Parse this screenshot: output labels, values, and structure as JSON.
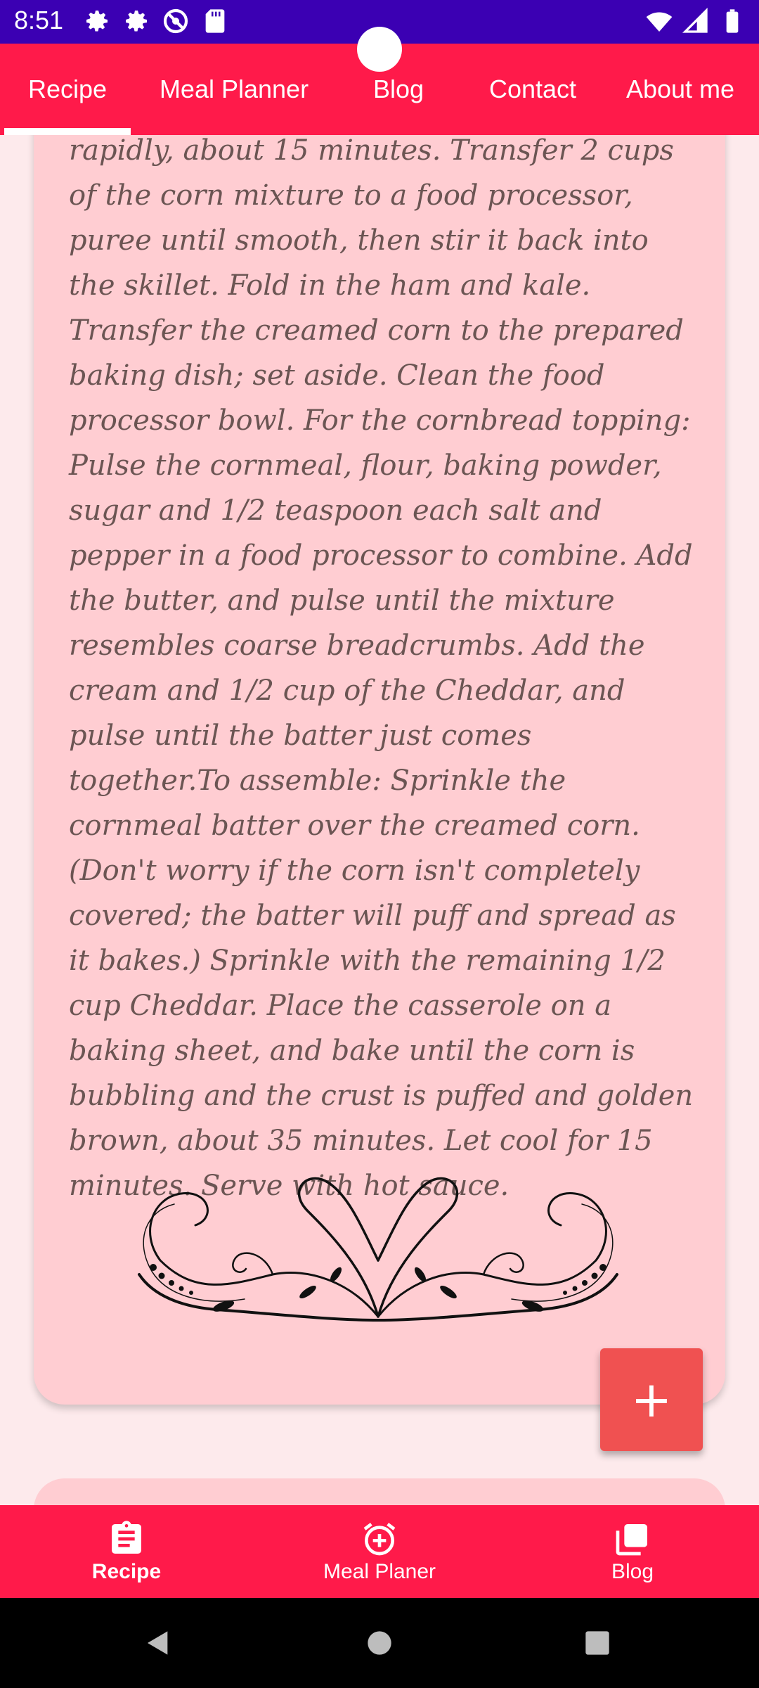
{
  "status_bar": {
    "time": "8:51",
    "icons_left": [
      "settings-icon",
      "settings-icon",
      "do-not-disturb-icon",
      "sd-card-icon"
    ],
    "icons_right": [
      "wifi-icon",
      "signal-icon",
      "battery-icon"
    ]
  },
  "top_tabs": [
    {
      "label": "Recipe",
      "active": true
    },
    {
      "label": "Meal Planner",
      "active": false
    },
    {
      "label": "Blog",
      "active": false
    },
    {
      "label": "Contact",
      "active": false
    },
    {
      "label": "About me",
      "active": false
    }
  ],
  "recipe": {
    "instructions": "rapidly, about 15 minutes. Transfer 2 cups of the corn mixture to a food processor, puree until smooth, then stir it back into the skillet. Fold in the ham and kale. Transfer the creamed corn to the prepared baking dish; set aside. Clean the food processor bowl. For the cornbread topping: Pulse the cornmeal, flour, baking powder, sugar and 1/2 teaspoon each salt and pepper in a food processor to combine. Add the butter, and pulse until the mixture resembles coarse breadcrumbs. Add the cream and 1/2 cup of the Cheddar, and pulse until the batter just comes together.To assemble: Sprinkle the cornmeal batter over the creamed corn. (Don't worry if the corn isn't completely covered; the batter will puff and spread as it bakes.) Sprinkle with the remaining 1/2 cup Cheddar. Place the casserole on a baking sheet, and bake until the corn is bubbling and the crust is puffed and golden brown, about 35 minutes. Let cool for 15 minutes. Serve with hot sauce."
  },
  "fab": {
    "icon": "plus-icon",
    "symbol": "+"
  },
  "bottom_nav": [
    {
      "label": "Recipe",
      "icon": "clipboard-icon",
      "active": true
    },
    {
      "label": "Meal Planer",
      "icon": "alarm-add-icon",
      "active": false
    },
    {
      "label": "Blog",
      "icon": "library-icon",
      "active": false
    }
  ],
  "colors": {
    "status_bar": "#3b00b3",
    "accent": "#ff1a4a",
    "card": "#ffcdd2",
    "fab": "#f05151",
    "background": "#fdeaec"
  }
}
